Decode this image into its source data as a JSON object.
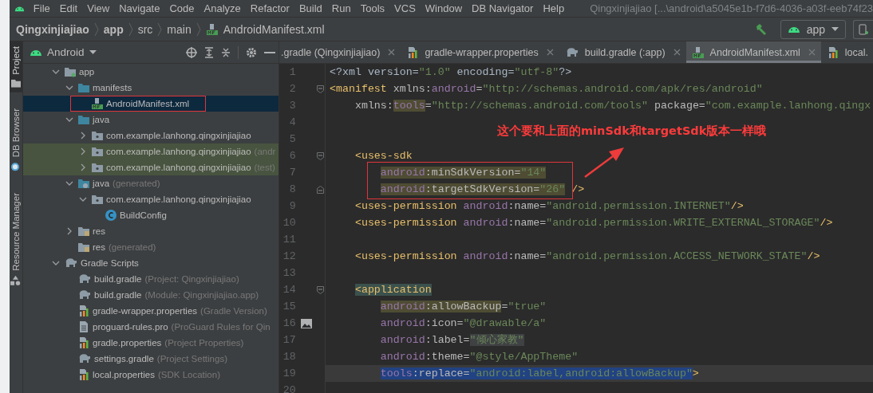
{
  "menu": [
    "File",
    "Edit",
    "View",
    "Navigate",
    "Code",
    "Analyze",
    "Refactor",
    "Build",
    "Run",
    "Tools",
    "VCS",
    "Window",
    "DB Navigator",
    "Help"
  ],
  "window_title": "Qingxinjiajiao [...\\android\\a5045e1b-f7d6-4036-a03f-eeb74f23",
  "breadcrumb": [
    {
      "label": "Qingxinjiajiao",
      "bold": true
    },
    {
      "label": "app",
      "bold": true
    },
    {
      "label": "src",
      "bold": false
    },
    {
      "label": "main",
      "bold": false
    },
    {
      "label": "AndroidManifest.xml",
      "bold": false,
      "kind": "manifest"
    }
  ],
  "run_config": {
    "label": "app"
  },
  "tool_tabs": [
    {
      "label": "Project",
      "selected": true,
      "kind": "folder"
    },
    {
      "label": "DB Browser",
      "selected": false,
      "kind": "db"
    },
    {
      "label": "Resource Manager",
      "selected": false,
      "kind": "shapes"
    }
  ],
  "project": {
    "view": "Android",
    "tree": [
      {
        "label": "app",
        "kind": "module",
        "expanded": true,
        "selected": false,
        "children": [
          {
            "label": "manifests",
            "kind": "folder",
            "expanded": true,
            "selected": false,
            "children": [
              {
                "label": "AndroidManifest.xml",
                "kind": "manifest",
                "selected": true,
                "annotated": true
              }
            ]
          },
          {
            "label": "java",
            "kind": "folder",
            "expanded": true,
            "selected": false,
            "children": [
              {
                "label": "com.example.lanhong.qingxinjiajiao",
                "kind": "package",
                "expanded": false,
                "selected": false
              },
              {
                "label": "com.example.lanhong.qingxinjiajiao",
                "suffix": "(andr",
                "kind": "package",
                "expanded": false,
                "selected": false,
                "test_source": true
              },
              {
                "label": "com.example.lanhong.qingxinjiajiao",
                "suffix": "(test)",
                "kind": "package",
                "expanded": false,
                "selected": false,
                "test_source": true
              }
            ]
          },
          {
            "label": "java",
            "suffix": "(generated)",
            "kind": "gen-folder",
            "expanded": true,
            "selected": false,
            "children": [
              {
                "label": "com.example.lanhong.qingxinjiajiao",
                "kind": "package",
                "expanded": true,
                "selected": false,
                "children": [
                  {
                    "label": "BuildConfig",
                    "kind": "class",
                    "selected": false
                  }
                ]
              }
            ]
          },
          {
            "label": "res",
            "kind": "res-folder",
            "expanded": false,
            "selected": false
          },
          {
            "label": "res",
            "suffix": "(generated)",
            "kind": "res-folder",
            "selected": false
          }
        ]
      },
      {
        "label": "Gradle Scripts",
        "kind": "gradle",
        "expanded": true,
        "selected": false,
        "children": [
          {
            "label": "build.gradle",
            "suffix": "(Project: Qingxinjiajiao)",
            "kind": "gradle",
            "selected": false
          },
          {
            "label": "build.gradle",
            "suffix": "(Module: Qingxinjiajiao.app)",
            "kind": "gradle",
            "selected": false
          },
          {
            "label": "gradle-wrapper.properties",
            "suffix": "(Gradle Version)",
            "kind": "properties",
            "selected": false
          },
          {
            "label": "proguard-rules.pro",
            "suffix": "(ProGuard Rules for Qin",
            "kind": "text",
            "selected": false
          },
          {
            "label": "gradle.properties",
            "suffix": "(Project Properties)",
            "kind": "properties",
            "selected": false
          },
          {
            "label": "settings.gradle",
            "suffix": "(Project Settings)",
            "kind": "gradle",
            "selected": false
          },
          {
            "label": "local.properties",
            "suffix": "(SDK Location)",
            "kind": "properties",
            "selected": false
          }
        ]
      }
    ]
  },
  "editor_tabs": [
    {
      "label": ".gradle (Qingxinjiajiao)",
      "selected": false
    },
    {
      "label": "gradle-wrapper.properties",
      "selected": false,
      "kind": "properties"
    },
    {
      "label": "build.gradle (:app)",
      "selected": false,
      "kind": "gradle"
    },
    {
      "label": "AndroidManifest.xml",
      "selected": true,
      "kind": "manifest"
    },
    {
      "label": "local.",
      "selected": false,
      "kind": "properties"
    }
  ],
  "code_lines": [
    {
      "n": "1",
      "tokens": [
        {
          "t": "<?xml version=",
          "kind": "plain"
        },
        {
          "t": "\"1.0\"",
          "kind": "str"
        },
        {
          "t": " encoding=",
          "kind": "plain"
        },
        {
          "t": "\"utf-8\"",
          "kind": "str"
        },
        {
          "t": "?>",
          "kind": "plain"
        }
      ]
    },
    {
      "n": "2",
      "fold_start": true,
      "tokens": [
        {
          "t": "<manifest ",
          "kind": "tag"
        },
        {
          "t": "xmlns:",
          "kind": "attr"
        },
        {
          "t": "android",
          "kind": "ns"
        },
        {
          "t": "=",
          "kind": "attr"
        },
        {
          "t": "\"http://schemas.android.com/apk/res/android\"",
          "kind": "str"
        }
      ]
    },
    {
      "n": "3",
      "tokens": [
        {
          "t": "    xmlns:",
          "kind": "attr"
        },
        {
          "t": "tools",
          "kind": "ns",
          "usage": true
        },
        {
          "t": "=",
          "kind": "attr"
        },
        {
          "t": "\"http://schemas.android.com/tools\"",
          "kind": "str"
        },
        {
          "t": " package=",
          "kind": "attr"
        },
        {
          "t": "\"com.example.lanhong.qingx",
          "kind": "str"
        }
      ]
    },
    {
      "n": "4"
    },
    {
      "n": "5"
    },
    {
      "n": "6",
      "fold_start": true,
      "tokens": [
        {
          "t": "    <uses-sdk",
          "kind": "tag"
        }
      ]
    },
    {
      "n": "7",
      "tokens": [
        {
          "t": "        android",
          "kind": "ns",
          "usage": true
        },
        {
          "t": ":minSdkVersion=",
          "kind": "attr",
          "usage": true
        },
        {
          "t": "\"14\"",
          "kind": "str",
          "usage": true
        }
      ]
    },
    {
      "n": "8",
      "fold_end": true,
      "tokens": [
        {
          "t": "        android",
          "kind": "ns",
          "usage": true
        },
        {
          "t": ":targetSdkVersion=",
          "kind": "attr",
          "usage": true
        },
        {
          "t": "\"26\"",
          "kind": "str",
          "usage": true
        },
        {
          "t": " />",
          "kind": "tag"
        }
      ]
    },
    {
      "n": "9",
      "tokens": [
        {
          "t": "    <uses-permission ",
          "kind": "tag"
        },
        {
          "t": "android",
          "kind": "ns"
        },
        {
          "t": ":name=",
          "kind": "attr"
        },
        {
          "t": "\"android.permission.INTERNET\"",
          "kind": "str"
        },
        {
          "t": "/>",
          "kind": "tag"
        }
      ]
    },
    {
      "n": "10",
      "tokens": [
        {
          "t": "    <uses-permission ",
          "kind": "tag"
        },
        {
          "t": "android",
          "kind": "ns"
        },
        {
          "t": ":name=",
          "kind": "attr"
        },
        {
          "t": "\"android.permission.WRITE_EXTERNAL_STORAGE\"",
          "kind": "str"
        },
        {
          "t": "/>",
          "kind": "tag"
        }
      ]
    },
    {
      "n": "11"
    },
    {
      "n": "12",
      "tokens": [
        {
          "t": "    <uses-permission ",
          "kind": "tag"
        },
        {
          "t": "android",
          "kind": "ns"
        },
        {
          "t": ":name=",
          "kind": "attr"
        },
        {
          "t": "\"android.permission.ACCESS_NETWORK_STATE\"",
          "kind": "str"
        },
        {
          "t": "/>",
          "kind": "tag"
        }
      ]
    },
    {
      "n": "13"
    },
    {
      "n": "14",
      "fold_start": true,
      "tokens": [
        {
          "t": "    <application",
          "kind": "tag",
          "tag_match": true
        }
      ]
    },
    {
      "n": "15",
      "tokens": [
        {
          "t": "        android",
          "kind": "ns",
          "usage": true
        },
        {
          "t": ":allowBackup",
          "kind": "attr",
          "usage": true
        },
        {
          "t": "=",
          "kind": "attr"
        },
        {
          "t": "\"true\"",
          "kind": "str"
        }
      ]
    },
    {
      "n": "16",
      "image_preview": true,
      "tokens": [
        {
          "t": "        android",
          "kind": "ns"
        },
        {
          "t": ":icon=",
          "kind": "attr"
        },
        {
          "t": "\"@drawable/a\"",
          "kind": "str"
        }
      ]
    },
    {
      "n": "17",
      "tokens": [
        {
          "t": "        android",
          "kind": "ns"
        },
        {
          "t": ":label=",
          "kind": "attr"
        },
        {
          "t": "\"倾心家教\"",
          "kind": "str",
          "folded": true
        }
      ]
    },
    {
      "n": "18",
      "tokens": [
        {
          "t": "        android",
          "kind": "ns"
        },
        {
          "t": ":theme=",
          "kind": "attr"
        },
        {
          "t": "\"@style/AppTheme\"",
          "kind": "str"
        }
      ]
    },
    {
      "n": "19",
      "current": true,
      "tokens": [
        {
          "t": "        tools",
          "kind": "ns",
          "selected": true
        },
        {
          "t": ":replace=",
          "kind": "attr",
          "selected": true
        },
        {
          "t": "\"android:label,android:allowBackup\"",
          "kind": "str",
          "selected": true
        },
        {
          "t": ">",
          "kind": "tag",
          "selected": false
        }
      ]
    },
    {
      "n": "20"
    }
  ],
  "annotation": {
    "text": "这个要和上面的minSdk和targetSdk版本一样哦"
  }
}
